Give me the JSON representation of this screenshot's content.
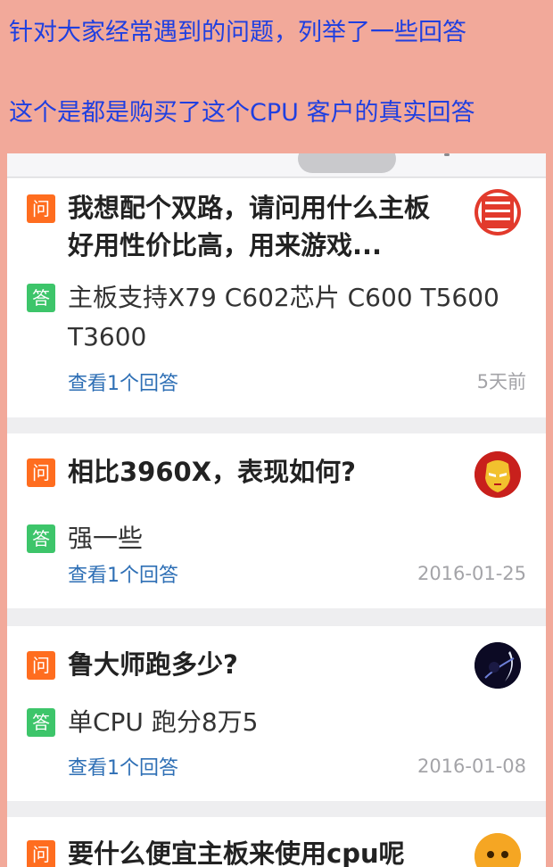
{
  "banner": {
    "line1": "针对大家经常遇到的问题，列举了一些回答",
    "line2": "这个是都是购买了这个CPU 客户的真实回答"
  },
  "labels": {
    "question_badge": "问",
    "answer_badge": "答"
  },
  "qa_items": [
    {
      "question": "我想配个双路，请问用什么主板好用性价比高，用来游戏...",
      "answer": "主板支持X79 C602芯片 C600 T5600 T3600",
      "view_link": "查看1个回答",
      "time": "5天前",
      "avatar_icon": "red-seal-avatar-icon"
    },
    {
      "question": "相比3960X，表现如何?",
      "answer": "强一些",
      "view_link": "查看1个回答",
      "time": "2016-01-25",
      "avatar_icon": "ironman-avatar-icon"
    },
    {
      "question": "鲁大师跑多少?",
      "answer": "单CPU 跑分8万5",
      "view_link": "查看1个回答",
      "time": "2016-01-08",
      "avatar_icon": "dark-planet-avatar-icon"
    },
    {
      "question": "要什么便宜主板来使用cpu呢",
      "avatar_icon": "yellow-face-avatar-icon"
    }
  ],
  "colors": {
    "banner_bg": "#f2a99a",
    "banner_text": "#1f3fe0",
    "question_badge": "#ff6d1f",
    "answer_badge": "#3dc56a",
    "link": "#2e6fb5",
    "time_text": "#a4a4a8"
  }
}
